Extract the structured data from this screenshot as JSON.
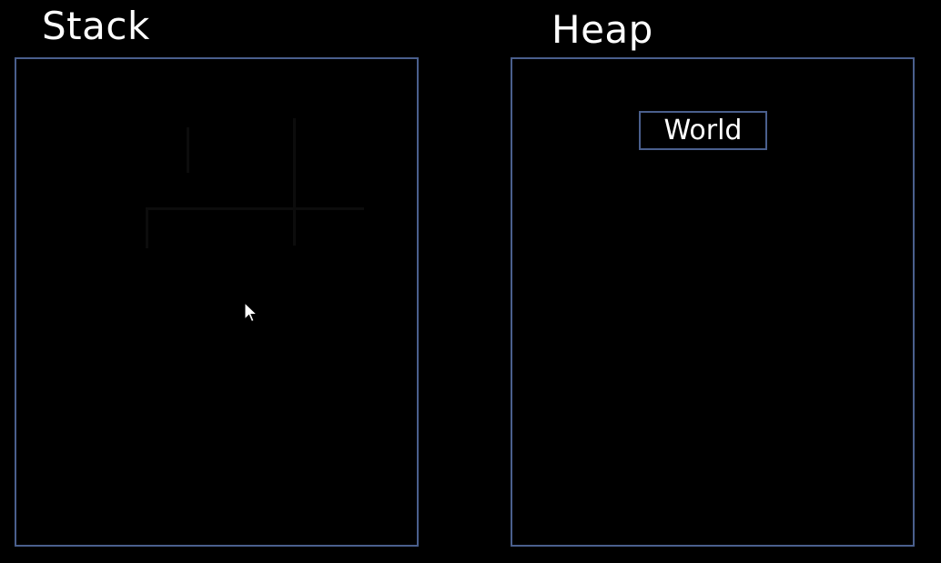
{
  "stack": {
    "title": "Stack"
  },
  "heap": {
    "title": "Heap",
    "objects": [
      {
        "label": "World"
      }
    ]
  },
  "colors": {
    "background": "#000000",
    "border": "#4a5f8d",
    "text": "#ffffff"
  },
  "icons": {
    "pointer": "mouse-cursor-icon"
  }
}
